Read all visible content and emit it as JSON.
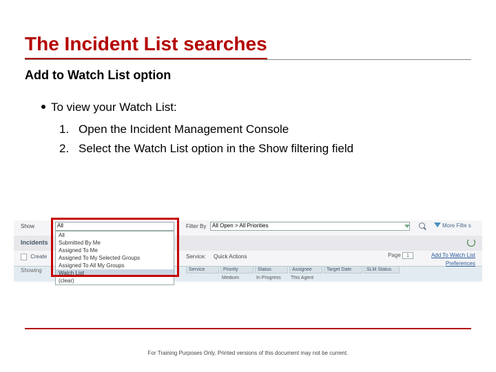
{
  "title": "The Incident List searches",
  "subtitle": "Add to Watch List option",
  "bullet": "To view your Watch List:",
  "steps": [
    "Open the Incident Management Console",
    "Select the Watch List option in the Show filtering field"
  ],
  "screenshot": {
    "show_label": "Show",
    "show_value": "All",
    "dd_items": [
      "All",
      "Submitted By Me",
      "Assigned To Me",
      "Assigned To My Selected Groups",
      "Assigned To All My Groups",
      "Watch List",
      "(clear)"
    ],
    "dd_selected_index": 5,
    "incidents_label": "Incidents",
    "create_label": "Create",
    "showing_label": "Showing",
    "filter_by_label": "Filter By",
    "filter_by_value": "All Open > All Priorities",
    "more_filters": "More Filte s",
    "service_label": "Service:",
    "quick_actions": "Quick Actions",
    "add_link": "Add To Watch List",
    "pref_link": "Preferences",
    "page_label": "Page",
    "page_value": "1",
    "col_headers": [
      "Service",
      "Priority",
      "Status",
      "Assignee",
      "Target Date",
      "SLM Status"
    ],
    "sample_row": [
      "",
      "Medium",
      "In Progress",
      "This Agent",
      "",
      ""
    ]
  },
  "footer": "For Training Purposes Only. Printed versions of this document may not be current."
}
